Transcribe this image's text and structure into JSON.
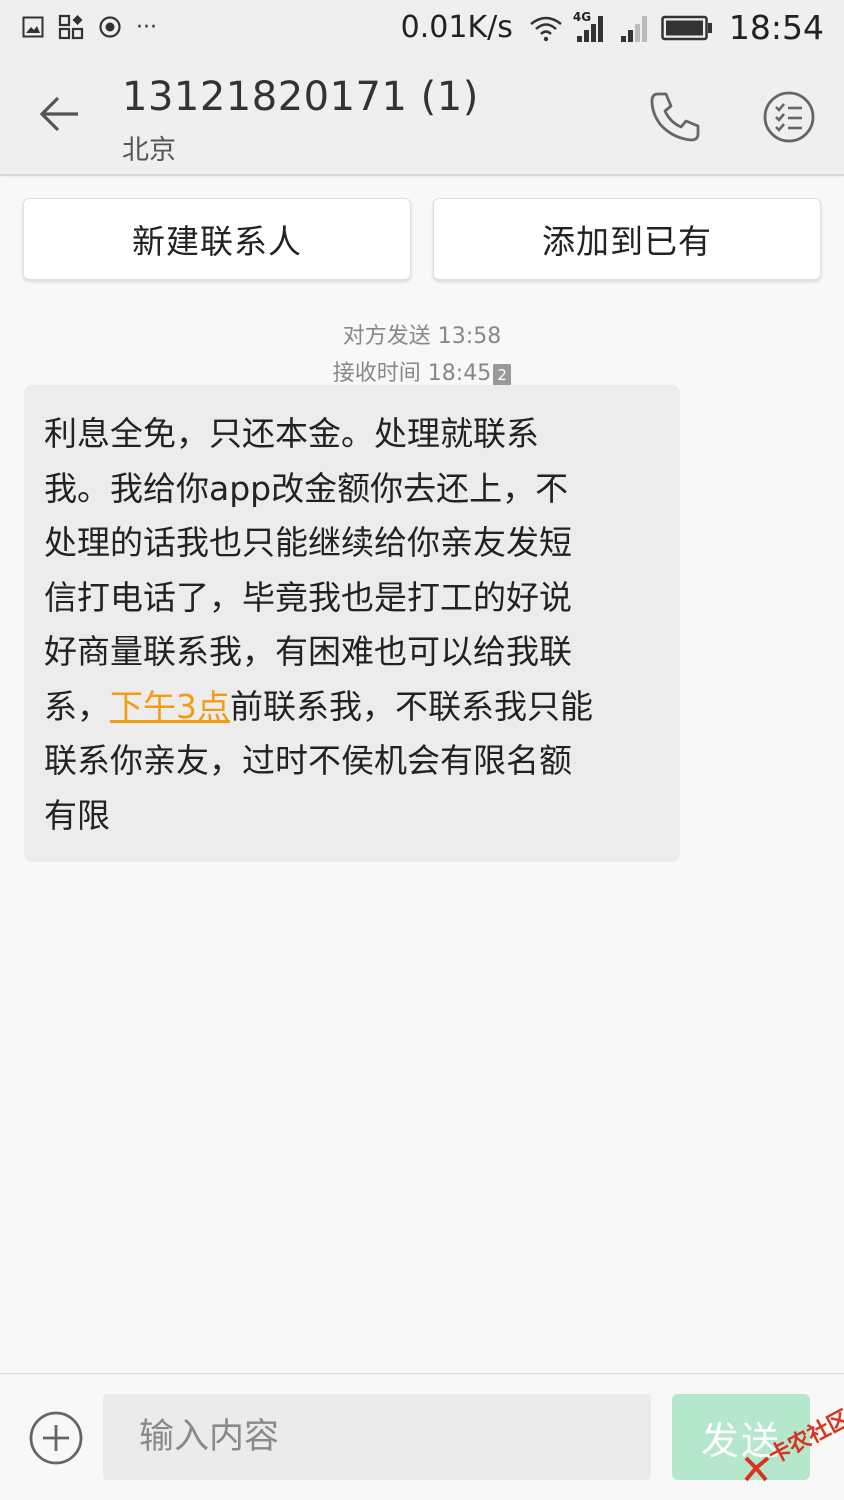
{
  "status_bar": {
    "net_speed": "0.01K/s",
    "network_type": "4G",
    "time": "18:54",
    "icons": [
      "image-icon",
      "apps-icon",
      "record-icon",
      "more-dots-icon",
      "wifi-icon",
      "signal-icon",
      "signal-weak-icon",
      "battery-icon"
    ],
    "more_dots": "···"
  },
  "header": {
    "title": "13121820171 (1)",
    "subtitle": "北京"
  },
  "actions": {
    "new_contact": "新建联系人",
    "add_existing": "添加到已有"
  },
  "message": {
    "sent_label": "对方发送 13:58",
    "received_label": "接收时间 18:45",
    "sim_slot": "2",
    "lines": [
      " 利息全免，只还本金。处理就联系",
      "我。我给你app改金额你去还上，不",
      "处理的话我也只能继续给你亲友发短",
      "信打电话了，毕竟我也是打工的好说",
      "好商量联系我，有困难也可以给我联"
    ],
    "line6_before": "系，",
    "line6_link": "下午3点",
    "line6_after": "前联系我，不联系我只能",
    "line7": "联系你亲友，过时不侯机会有限名额",
    "line8": "有限"
  },
  "composer": {
    "placeholder": "输入内容",
    "send_label": "发送"
  },
  "watermark": {
    "text": "卡农社区"
  },
  "colors": {
    "link": "#f39c12",
    "send_button": "#b5e7cc",
    "watermark": "#d9331f"
  }
}
